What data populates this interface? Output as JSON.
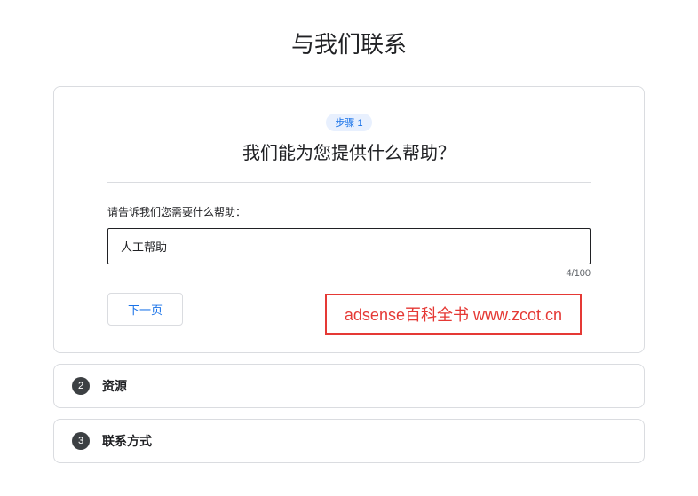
{
  "page": {
    "title": "与我们联系"
  },
  "step1": {
    "badge": "步骤 1",
    "question": "我们能为您提供什么帮助？",
    "label": "请告诉我们您需要什么帮助：",
    "input_value": "人工帮助",
    "counter": "4/100",
    "next_button": "下一页"
  },
  "step2": {
    "number": "2",
    "title": "资源"
  },
  "step3": {
    "number": "3",
    "title": "联系方式"
  },
  "watermark": {
    "text": "adsense百科全书 www.zcot.cn"
  }
}
